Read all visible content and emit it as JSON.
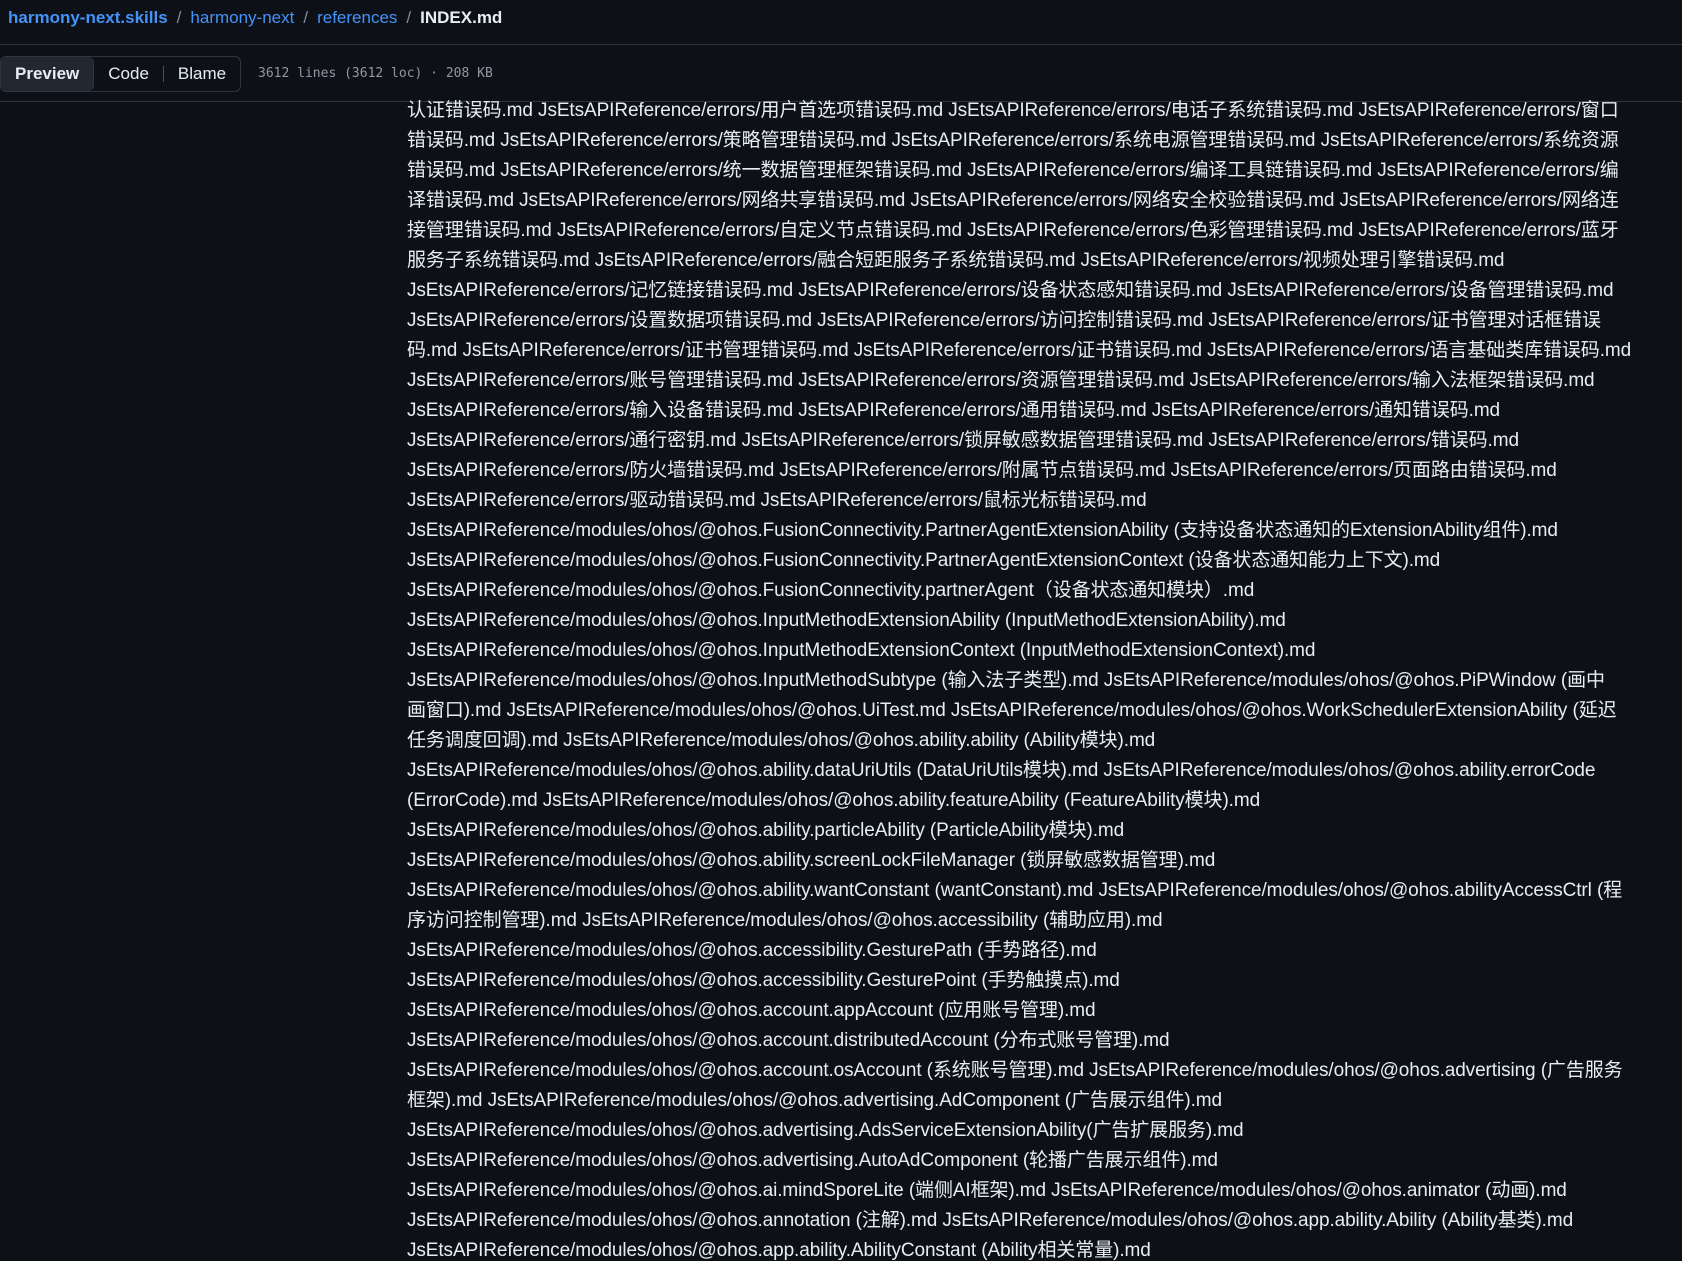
{
  "breadcrumb": {
    "repo": "harmony-next.skills",
    "folder1": "harmony-next",
    "folder2": "references",
    "file": "INDEX.md",
    "separator": "/"
  },
  "toolbar": {
    "tabs": [
      "Preview",
      "Code",
      "Blame"
    ],
    "file_info": "3612 lines (3612 loc) · 208 KB"
  },
  "content_lines": [
    "认证错误码.md JsEtsAPIReference/errors/用户首选项错误码.md JsEtsAPIReference/errors/电话子系统错误码.md JsEtsAPIReference/errors/窗口",
    "错误码.md JsEtsAPIReference/errors/策略管理错误码.md JsEtsAPIReference/errors/系统电源管理错误码.md JsEtsAPIReference/errors/系统资源",
    "错误码.md JsEtsAPIReference/errors/统一数据管理框架错误码.md JsEtsAPIReference/errors/编译工具链错误码.md JsEtsAPIReference/errors/编",
    "译错误码.md JsEtsAPIReference/errors/网络共享错误码.md JsEtsAPIReference/errors/网络安全校验错误码.md JsEtsAPIReference/errors/网络连",
    "接管理错误码.md JsEtsAPIReference/errors/自定义节点错误码.md JsEtsAPIReference/errors/色彩管理错误码.md JsEtsAPIReference/errors/蓝牙",
    "服务子系统错误码.md JsEtsAPIReference/errors/融合短距服务子系统错误码.md JsEtsAPIReference/errors/视频处理引擎错误码.md",
    "JsEtsAPIReference/errors/记忆链接错误码.md JsEtsAPIReference/errors/设备状态感知错误码.md JsEtsAPIReference/errors/设备管理错误码.md",
    "JsEtsAPIReference/errors/设置数据项错误码.md JsEtsAPIReference/errors/访问控制错误码.md JsEtsAPIReference/errors/证书管理对话框错误",
    "码.md JsEtsAPIReference/errors/证书管理错误码.md JsEtsAPIReference/errors/证书错误码.md JsEtsAPIReference/errors/语言基础类库错误码.md",
    "JsEtsAPIReference/errors/账号管理错误码.md JsEtsAPIReference/errors/资源管理错误码.md JsEtsAPIReference/errors/输入法框架错误码.md",
    "JsEtsAPIReference/errors/输入设备错误码.md JsEtsAPIReference/errors/通用错误码.md JsEtsAPIReference/errors/通知错误码.md",
    "JsEtsAPIReference/errors/通行密钥.md JsEtsAPIReference/errors/锁屏敏感数据管理错误码.md JsEtsAPIReference/errors/错误码.md",
    "JsEtsAPIReference/errors/防火墙错误码.md JsEtsAPIReference/errors/附属节点错误码.md JsEtsAPIReference/errors/页面路由错误码.md",
    "JsEtsAPIReference/errors/驱动错误码.md JsEtsAPIReference/errors/鼠标光标错误码.md",
    "JsEtsAPIReference/modules/ohos/@ohos.FusionConnectivity.PartnerAgentExtensionAbility (支持设备状态通知的ExtensionAbility组件).md",
    "JsEtsAPIReference/modules/ohos/@ohos.FusionConnectivity.PartnerAgentExtensionContext (设备状态通知能力上下文).md",
    "JsEtsAPIReference/modules/ohos/@ohos.FusionConnectivity.partnerAgent（设备状态通知模块）.md",
    "JsEtsAPIReference/modules/ohos/@ohos.InputMethodExtensionAbility (InputMethodExtensionAbility).md",
    "JsEtsAPIReference/modules/ohos/@ohos.InputMethodExtensionContext (InputMethodExtensionContext).md",
    "JsEtsAPIReference/modules/ohos/@ohos.InputMethodSubtype (输入法子类型).md JsEtsAPIReference/modules/ohos/@ohos.PiPWindow (画中",
    "画窗口).md JsEtsAPIReference/modules/ohos/@ohos.UiTest.md JsEtsAPIReference/modules/ohos/@ohos.WorkSchedulerExtensionAbility (延迟",
    "任务调度回调).md JsEtsAPIReference/modules/ohos/@ohos.ability.ability (Ability模块).md",
    "JsEtsAPIReference/modules/ohos/@ohos.ability.dataUriUtils (DataUriUtils模块).md JsEtsAPIReference/modules/ohos/@ohos.ability.errorCode",
    "(ErrorCode).md JsEtsAPIReference/modules/ohos/@ohos.ability.featureAbility (FeatureAbility模块).md",
    "JsEtsAPIReference/modules/ohos/@ohos.ability.particleAbility (ParticleAbility模块).md",
    "JsEtsAPIReference/modules/ohos/@ohos.ability.screenLockFileManager (锁屏敏感数据管理).md",
    "JsEtsAPIReference/modules/ohos/@ohos.ability.wantConstant (wantConstant).md JsEtsAPIReference/modules/ohos/@ohos.abilityAccessCtrl (程",
    "序访问控制管理).md JsEtsAPIReference/modules/ohos/@ohos.accessibility (辅助应用).md",
    "JsEtsAPIReference/modules/ohos/@ohos.accessibility.GesturePath (手势路径).md",
    "JsEtsAPIReference/modules/ohos/@ohos.accessibility.GesturePoint (手势触摸点).md",
    "JsEtsAPIReference/modules/ohos/@ohos.account.appAccount (应用账号管理).md",
    "JsEtsAPIReference/modules/ohos/@ohos.account.distributedAccount (分布式账号管理).md",
    "JsEtsAPIReference/modules/ohos/@ohos.account.osAccount (系统账号管理).md JsEtsAPIReference/modules/ohos/@ohos.advertising (广告服务",
    "框架).md JsEtsAPIReference/modules/ohos/@ohos.advertising.AdComponent (广告展示组件).md",
    "JsEtsAPIReference/modules/ohos/@ohos.advertising.AdsServiceExtensionAbility(广告扩展服务).md",
    "JsEtsAPIReference/modules/ohos/@ohos.advertising.AutoAdComponent (轮播广告展示组件).md",
    "JsEtsAPIReference/modules/ohos/@ohos.ai.mindSporeLite (端侧AI框架).md JsEtsAPIReference/modules/ohos/@ohos.animator (动画).md",
    "JsEtsAPIReference/modules/ohos/@ohos.annotation (注解).md JsEtsAPIReference/modules/ohos/@ohos.app.ability.Ability (Ability基类).md",
    "JsEtsAPIReference/modules/ohos/@ohos.app.ability.AbilityConstant (Ability相关常量).md"
  ]
}
